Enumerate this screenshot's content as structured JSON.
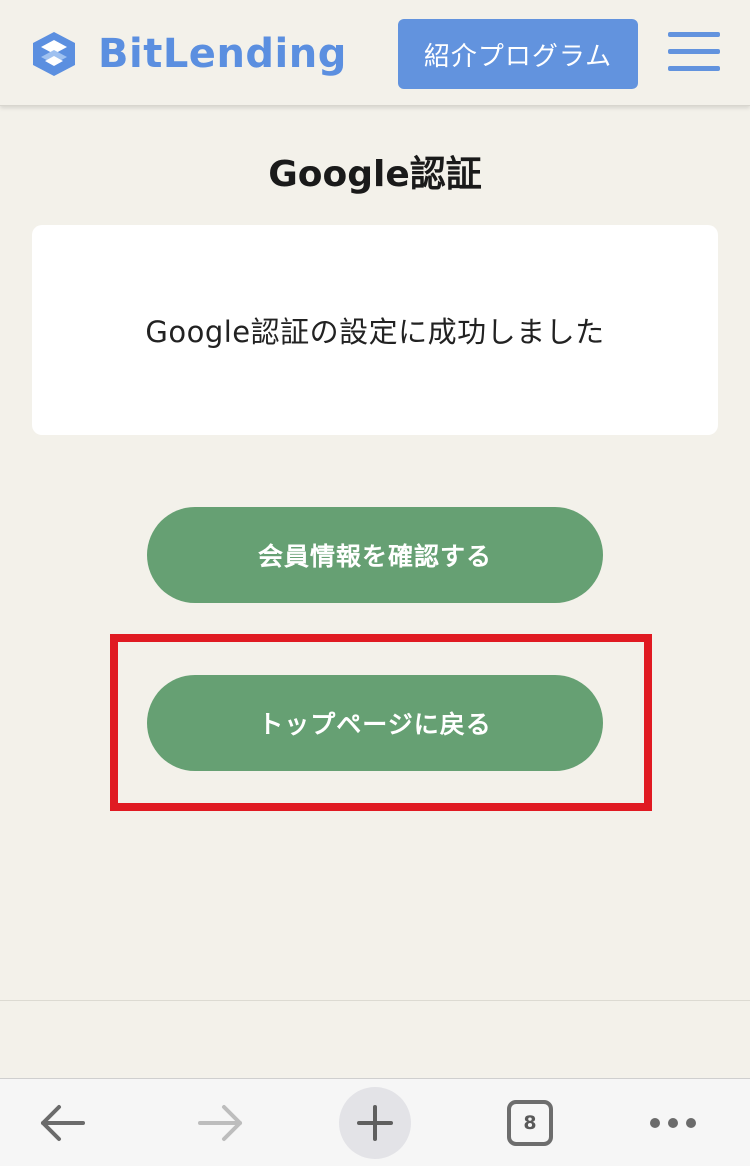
{
  "header": {
    "logo_text": "BitLending",
    "referral_button": "紹介プログラム",
    "menu_icon": "hamburger-icon"
  },
  "main": {
    "title": "Google認証",
    "message": "Google認証の設定に成功しました",
    "buttons": {
      "member_info": "会員情報を確認する",
      "back_to_top": "トップページに戻る"
    }
  },
  "browser_toolbar": {
    "back_icon": "back-arrow-icon",
    "forward_icon": "forward-arrow-icon",
    "new_tab_icon": "plus-icon",
    "tab_count": "8",
    "more_icon": "more-dots-icon"
  },
  "colors": {
    "brand_blue": "#6293de",
    "button_green": "#66a073",
    "background": "#f3f1ea",
    "highlight_red": "#e01a22"
  }
}
